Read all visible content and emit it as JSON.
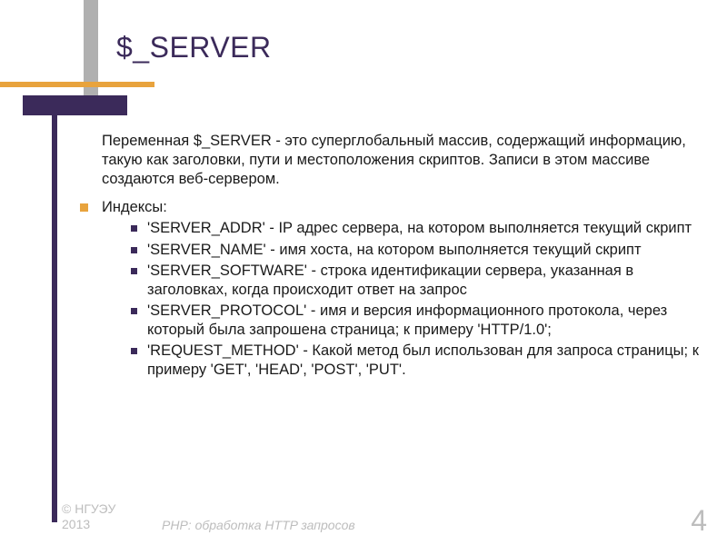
{
  "title": "$_SERVER",
  "intro": "Переменная $_SERVER - это суперглобальный массив, содержащий информацию, такую как заголовки, пути и местоположения скриптов. Записи в этом массиве создаются веб-сервером.",
  "indexes_label": "Индексы:",
  "indexes": [
    "'SERVER_ADDR'  - IP адрес сервера, на котором выполняется текущий скрипт",
    "'SERVER_NAME' - имя хоста, на котором выполняется текущий скрипт",
    "'SERVER_SOFTWARE' - строка идентификации сервера, указанная в заголовках, когда происходит ответ на запрос",
    "'SERVER_PROTOCOL' - имя и версия информационного протокола, через который была запрошена страница; к примеру 'HTTP/1.0';",
    "'REQUEST_METHOD' - Какой метод был использован для запроса страницы; к примеру 'GET', 'HEAD', 'POST', 'PUT'."
  ],
  "footer": {
    "copyright_line1": "© НГУЭУ",
    "copyright_line2": "2013",
    "subtitle": "PHP: обработка HTTP запросов",
    "page": "4"
  }
}
